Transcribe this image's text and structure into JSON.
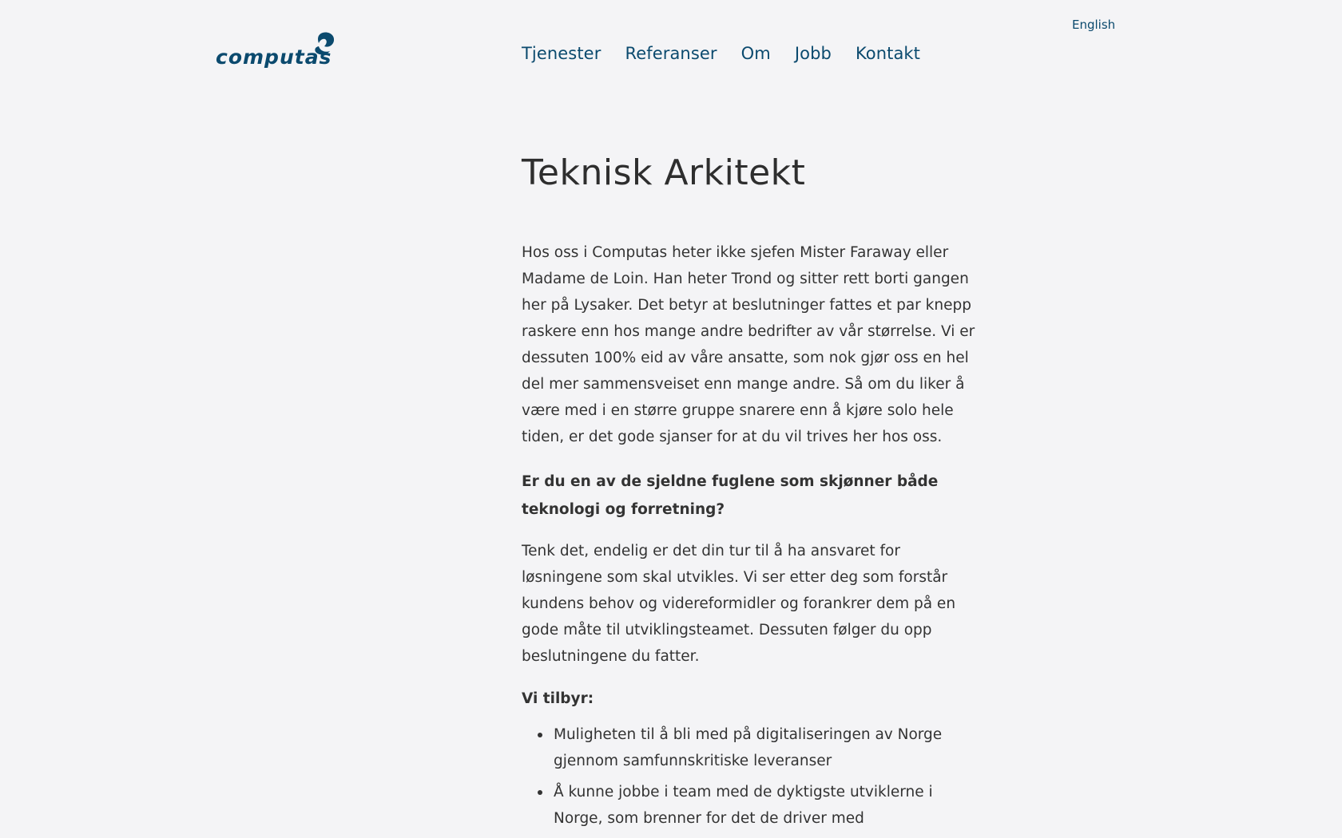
{
  "brand": {
    "logo_text": "computas",
    "color": "#0b4a6e"
  },
  "nav": {
    "items": [
      {
        "label": "Tjenester"
      },
      {
        "label": "Referanser"
      },
      {
        "label": "Om"
      },
      {
        "label": "Jobb"
      },
      {
        "label": "Kontakt"
      }
    ],
    "language_link": "English"
  },
  "article": {
    "title": "Teknisk Arkitekt",
    "intro": "Hos oss i Computas heter ikke sjefen Mister Faraway eller Madame de Loin. Han heter Trond og sitter rett borti gangen her på Lysaker. Det betyr at beslutninger fattes et par knepp raskere enn hos mange andre bedrifter av vår størrelse. Vi er dessuten 100% eid av våre ansatte, som nok gjør oss en hel del mer sammensveiset enn mange andre. Så om du liker å være med i en større gruppe snarere enn å kjøre solo hele tiden, er det gode sjanser for at du vil trives her hos oss.",
    "subheading": "Er du en av de sjeldne fuglene som skjønner både teknologi og forretning?",
    "paragraph": "Tenk det, endelig er det din tur til å ha ansvaret for løsningene som skal utvikles. Vi ser etter deg som forstår kundens behov og videreformidler og forankrer dem på en gode måte til utviklingsteamet. Dessuten følger du opp beslutningene du fatter.",
    "offer_heading": "Vi tilbyr:",
    "offers": [
      "Muligheten til å bli med på digitaliseringen av Norge gjennom samfunnskritiske leveranser",
      "Å kunne jobbe i team med de dyktigste utviklerne i Norge, som brenner for det de driver med"
    ]
  }
}
